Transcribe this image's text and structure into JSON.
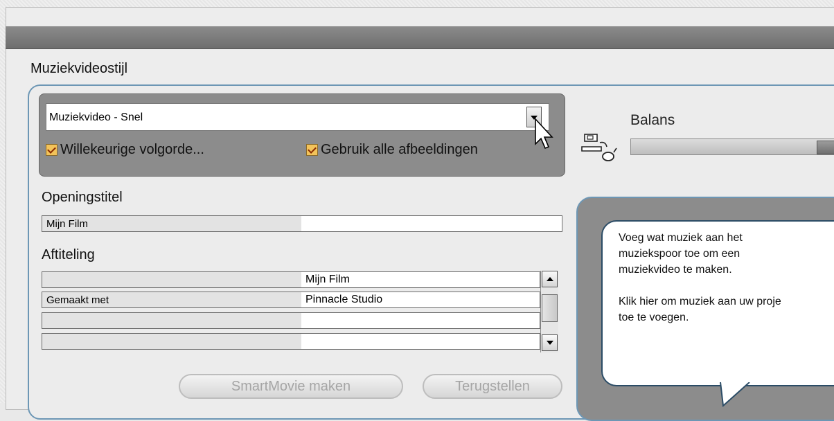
{
  "section_title": "Muziekvideostijl",
  "style": {
    "selected": "Muziekvideo - Snel",
    "options": [
      {
        "label": "Willekeurige volgorde...",
        "checked": true
      },
      {
        "label": "Gebruik alle afbeeldingen",
        "checked": true
      }
    ]
  },
  "opening": {
    "label": "Openingstitel",
    "key": "Mijn Film",
    "value": ""
  },
  "credits": {
    "label": "Aftiteling",
    "rows": [
      {
        "key": "",
        "value": "Mijn Film"
      },
      {
        "key": "Gemaakt met",
        "value": "Pinnacle Studio"
      },
      {
        "key": "",
        "value": ""
      },
      {
        "key": "",
        "value": ""
      }
    ]
  },
  "buttons": {
    "smartmovie": "SmartMovie maken",
    "reset": "Terugstellen"
  },
  "balance": {
    "label": "Balans"
  },
  "tip": {
    "line1": "Voeg wat muziek aan het",
    "line2": "muziekspoor toe om een",
    "line3": "muziekvideo te maken.",
    "line4": "Klik hier om muziek aan uw proje",
    "line5": "toe te voegen."
  },
  "icons": [
    "combo-dropdown-arrow-icon",
    "checkbox-checked-icon",
    "mouse-cursor-icon",
    "speaker-balance-icon",
    "scroll-up-icon",
    "scroll-down-icon"
  ],
  "colors": {
    "accent_border": "#6d97b5",
    "panel_gray": "#8c8c8c",
    "checkbox": "#f3c35a"
  }
}
